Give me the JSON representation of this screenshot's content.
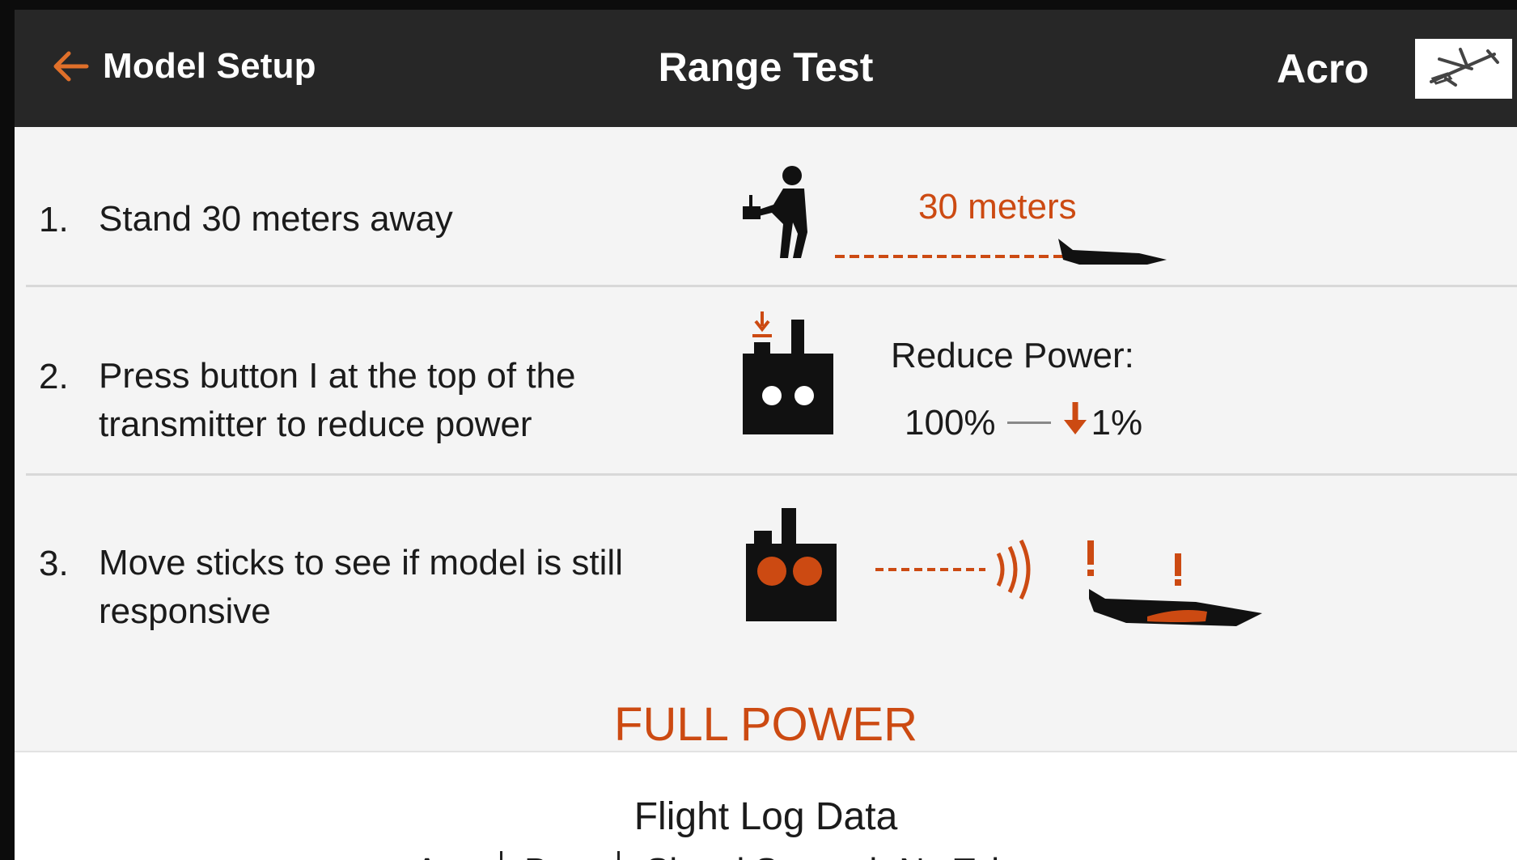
{
  "header": {
    "back_label": "Model Setup",
    "title": "Range Test",
    "model_name": "Acro",
    "model_icon": "airplane-icon"
  },
  "steps": [
    {
      "number": "1.",
      "lines": [
        "Stand 30 meters away"
      ],
      "illustration_label": "30 meters"
    },
    {
      "number": "2.",
      "lines": [
        "Press button I at the top of the",
        "transmitter to reduce power"
      ],
      "reduce_power_label": "Reduce Power:",
      "power_from": "100%",
      "power_to": "1%"
    },
    {
      "number": "3.",
      "lines": [
        "Move sticks to see if model is still",
        "responsive"
      ]
    }
  ],
  "status": "FULL POWER",
  "log": {
    "title": "Flight Log Data",
    "columns": [
      "A",
      "B",
      "Signal Strength No Telemetry"
    ]
  },
  "colors": {
    "header_bg": "#272727",
    "accent": "#cc4a12",
    "background": "#f4f4f4"
  }
}
